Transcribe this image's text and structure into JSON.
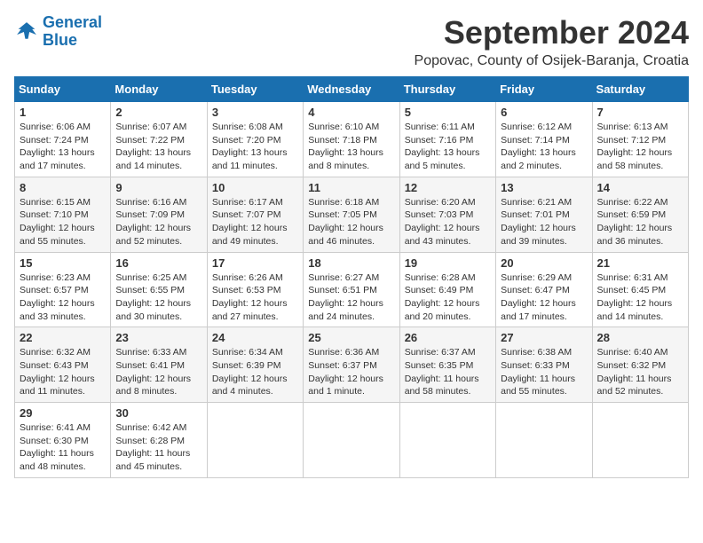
{
  "logo": {
    "line1": "General",
    "line2": "Blue"
  },
  "title": "September 2024",
  "location": "Popovac, County of Osijek-Baranja, Croatia",
  "weekdays": [
    "Sunday",
    "Monday",
    "Tuesday",
    "Wednesday",
    "Thursday",
    "Friday",
    "Saturday"
  ],
  "weeks": [
    [
      {
        "day": "1",
        "sunrise": "6:06 AM",
        "sunset": "7:24 PM",
        "daylight": "13 hours and 17 minutes."
      },
      {
        "day": "2",
        "sunrise": "6:07 AM",
        "sunset": "7:22 PM",
        "daylight": "13 hours and 14 minutes."
      },
      {
        "day": "3",
        "sunrise": "6:08 AM",
        "sunset": "7:20 PM",
        "daylight": "13 hours and 11 minutes."
      },
      {
        "day": "4",
        "sunrise": "6:10 AM",
        "sunset": "7:18 PM",
        "daylight": "13 hours and 8 minutes."
      },
      {
        "day": "5",
        "sunrise": "6:11 AM",
        "sunset": "7:16 PM",
        "daylight": "13 hours and 5 minutes."
      },
      {
        "day": "6",
        "sunrise": "6:12 AM",
        "sunset": "7:14 PM",
        "daylight": "13 hours and 2 minutes."
      },
      {
        "day": "7",
        "sunrise": "6:13 AM",
        "sunset": "7:12 PM",
        "daylight": "12 hours and 58 minutes."
      }
    ],
    [
      {
        "day": "8",
        "sunrise": "6:15 AM",
        "sunset": "7:10 PM",
        "daylight": "12 hours and 55 minutes."
      },
      {
        "day": "9",
        "sunrise": "6:16 AM",
        "sunset": "7:09 PM",
        "daylight": "12 hours and 52 minutes."
      },
      {
        "day": "10",
        "sunrise": "6:17 AM",
        "sunset": "7:07 PM",
        "daylight": "12 hours and 49 minutes."
      },
      {
        "day": "11",
        "sunrise": "6:18 AM",
        "sunset": "7:05 PM",
        "daylight": "12 hours and 46 minutes."
      },
      {
        "day": "12",
        "sunrise": "6:20 AM",
        "sunset": "7:03 PM",
        "daylight": "12 hours and 43 minutes."
      },
      {
        "day": "13",
        "sunrise": "6:21 AM",
        "sunset": "7:01 PM",
        "daylight": "12 hours and 39 minutes."
      },
      {
        "day": "14",
        "sunrise": "6:22 AM",
        "sunset": "6:59 PM",
        "daylight": "12 hours and 36 minutes."
      }
    ],
    [
      {
        "day": "15",
        "sunrise": "6:23 AM",
        "sunset": "6:57 PM",
        "daylight": "12 hours and 33 minutes."
      },
      {
        "day": "16",
        "sunrise": "6:25 AM",
        "sunset": "6:55 PM",
        "daylight": "12 hours and 30 minutes."
      },
      {
        "day": "17",
        "sunrise": "6:26 AM",
        "sunset": "6:53 PM",
        "daylight": "12 hours and 27 minutes."
      },
      {
        "day": "18",
        "sunrise": "6:27 AM",
        "sunset": "6:51 PM",
        "daylight": "12 hours and 24 minutes."
      },
      {
        "day": "19",
        "sunrise": "6:28 AM",
        "sunset": "6:49 PM",
        "daylight": "12 hours and 20 minutes."
      },
      {
        "day": "20",
        "sunrise": "6:29 AM",
        "sunset": "6:47 PM",
        "daylight": "12 hours and 17 minutes."
      },
      {
        "day": "21",
        "sunrise": "6:31 AM",
        "sunset": "6:45 PM",
        "daylight": "12 hours and 14 minutes."
      }
    ],
    [
      {
        "day": "22",
        "sunrise": "6:32 AM",
        "sunset": "6:43 PM",
        "daylight": "12 hours and 11 minutes."
      },
      {
        "day": "23",
        "sunrise": "6:33 AM",
        "sunset": "6:41 PM",
        "daylight": "12 hours and 8 minutes."
      },
      {
        "day": "24",
        "sunrise": "6:34 AM",
        "sunset": "6:39 PM",
        "daylight": "12 hours and 4 minutes."
      },
      {
        "day": "25",
        "sunrise": "6:36 AM",
        "sunset": "6:37 PM",
        "daylight": "12 hours and 1 minute."
      },
      {
        "day": "26",
        "sunrise": "6:37 AM",
        "sunset": "6:35 PM",
        "daylight": "11 hours and 58 minutes."
      },
      {
        "day": "27",
        "sunrise": "6:38 AM",
        "sunset": "6:33 PM",
        "daylight": "11 hours and 55 minutes."
      },
      {
        "day": "28",
        "sunrise": "6:40 AM",
        "sunset": "6:32 PM",
        "daylight": "11 hours and 52 minutes."
      }
    ],
    [
      {
        "day": "29",
        "sunrise": "6:41 AM",
        "sunset": "6:30 PM",
        "daylight": "11 hours and 48 minutes."
      },
      {
        "day": "30",
        "sunrise": "6:42 AM",
        "sunset": "6:28 PM",
        "daylight": "11 hours and 45 minutes."
      },
      null,
      null,
      null,
      null,
      null
    ]
  ]
}
